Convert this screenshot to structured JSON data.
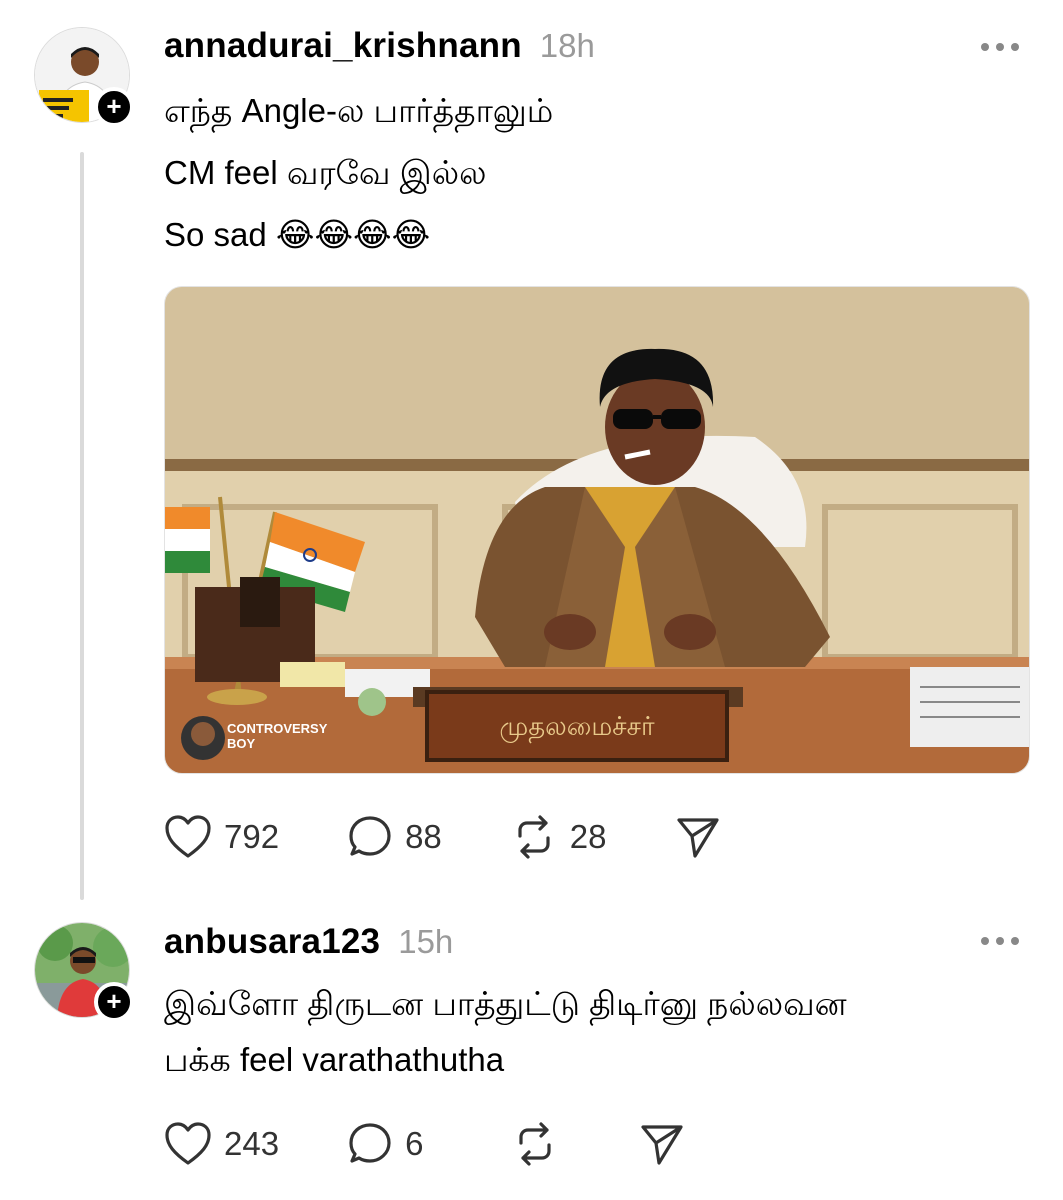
{
  "posts": [
    {
      "username": "annadurai_krishnann",
      "time": "18h",
      "lines": [
        "எந்த Angle-ல பார்த்தாலும்",
        "CM feel வரவே இல்ல",
        "So sad 😂😂😂😂"
      ],
      "media": {
        "watermark_line1": "CONTROVERSY",
        "watermark_line2": "BOY",
        "nameplate": "முதலமைச்சர்"
      },
      "likes": "792",
      "replies": "88",
      "reposts": "28"
    },
    {
      "username": "anbusara123",
      "time": "15h",
      "lines": [
        "இவ்ளோ திருடன பாத்துட்டு திடிர்னு நல்லவன",
        "பக்க feel varathathutha"
      ],
      "likes": "243",
      "replies": "6",
      "reposts": ""
    }
  ],
  "icons": {
    "like": "heart-icon",
    "reply": "comment-icon",
    "repost": "repost-icon",
    "share": "send-icon",
    "more": "more-dots-icon",
    "follow": "plus-icon"
  },
  "colors": {
    "timestamp": "#9a9a9a",
    "thread_line": "#dadada",
    "badge": "#000000"
  }
}
